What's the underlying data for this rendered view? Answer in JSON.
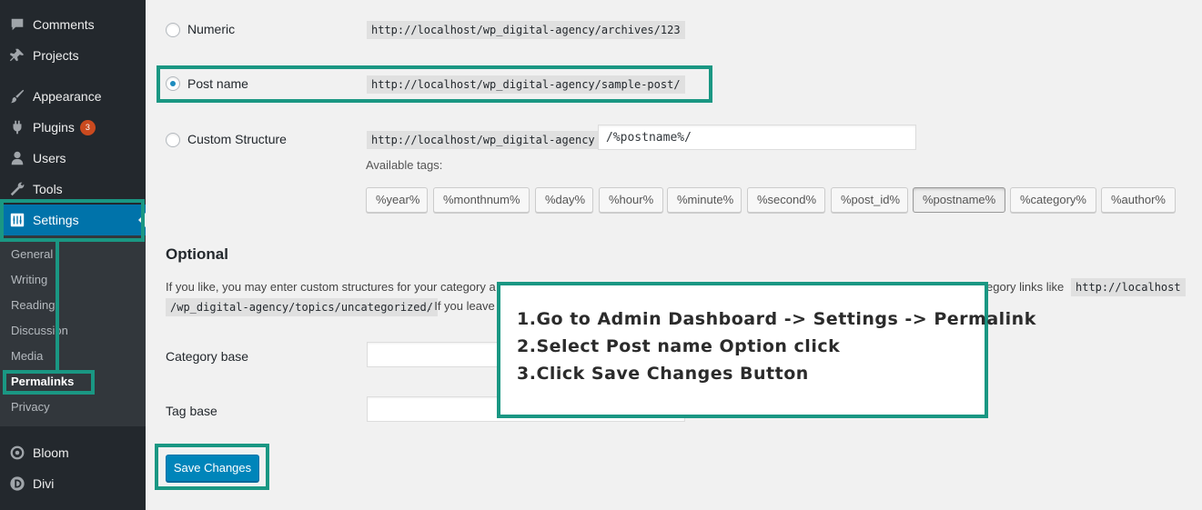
{
  "sidebar": {
    "items": [
      {
        "label": "Comments",
        "icon": "comment-icon"
      },
      {
        "label": "Projects",
        "icon": "pin-icon"
      },
      {
        "label": "Appearance",
        "icon": "brush-icon"
      },
      {
        "label": "Plugins",
        "icon": "plugin-icon",
        "badge": "3"
      },
      {
        "label": "Users",
        "icon": "user-icon"
      },
      {
        "label": "Tools",
        "icon": "wrench-icon"
      },
      {
        "label": "Settings",
        "icon": "settings-icon"
      },
      {
        "label": "Bloom",
        "icon": "bloom-icon"
      },
      {
        "label": "Divi",
        "icon": "divi-icon"
      }
    ],
    "submenu": [
      "General",
      "Writing",
      "Reading",
      "Discussion",
      "Media",
      "Permalinks",
      "Privacy"
    ]
  },
  "permalinks": {
    "options": [
      {
        "label": "Numeric",
        "example": "http://localhost/wp_digital-agency/archives/123",
        "checked": false
      },
      {
        "label": "Post name",
        "example": "http://localhost/wp_digital-agency/sample-post/",
        "checked": true
      },
      {
        "label": "Custom Structure",
        "example": "http://localhost/wp_digital-agency",
        "checked": false
      }
    ],
    "custom_value": "/%postname%/",
    "available_tags_label": "Available tags:",
    "tags": [
      "%year%",
      "%monthnum%",
      "%day%",
      "%hour%",
      "%minute%",
      "%second%",
      "%post_id%",
      "%postname%",
      "%category%",
      "%author%"
    ]
  },
  "optional": {
    "title": "Optional",
    "para_line1_start": "If you like, you may enter custom structures for your category a",
    "para_line1_end": "egory links like",
    "para_code1": "http://localhost",
    "para_code2": "/wp_digital-agency/topics/uncategorized/",
    "para_line2_end": ". If you leave t",
    "category_base_label": "Category base",
    "tag_base_label": "Tag base"
  },
  "save_label": "Save Changes",
  "callout": {
    "line1": "1.Go to Admin Dashboard -> Settings -> Permalink",
    "line2": "2.Select Post name Option click",
    "line3": "3.Click Save Changes Button"
  },
  "colors": {
    "highlight": "#1a9783",
    "active_menu": "#0073aa",
    "primary_button": "#0085ba",
    "badge": "#ca4a1f"
  }
}
